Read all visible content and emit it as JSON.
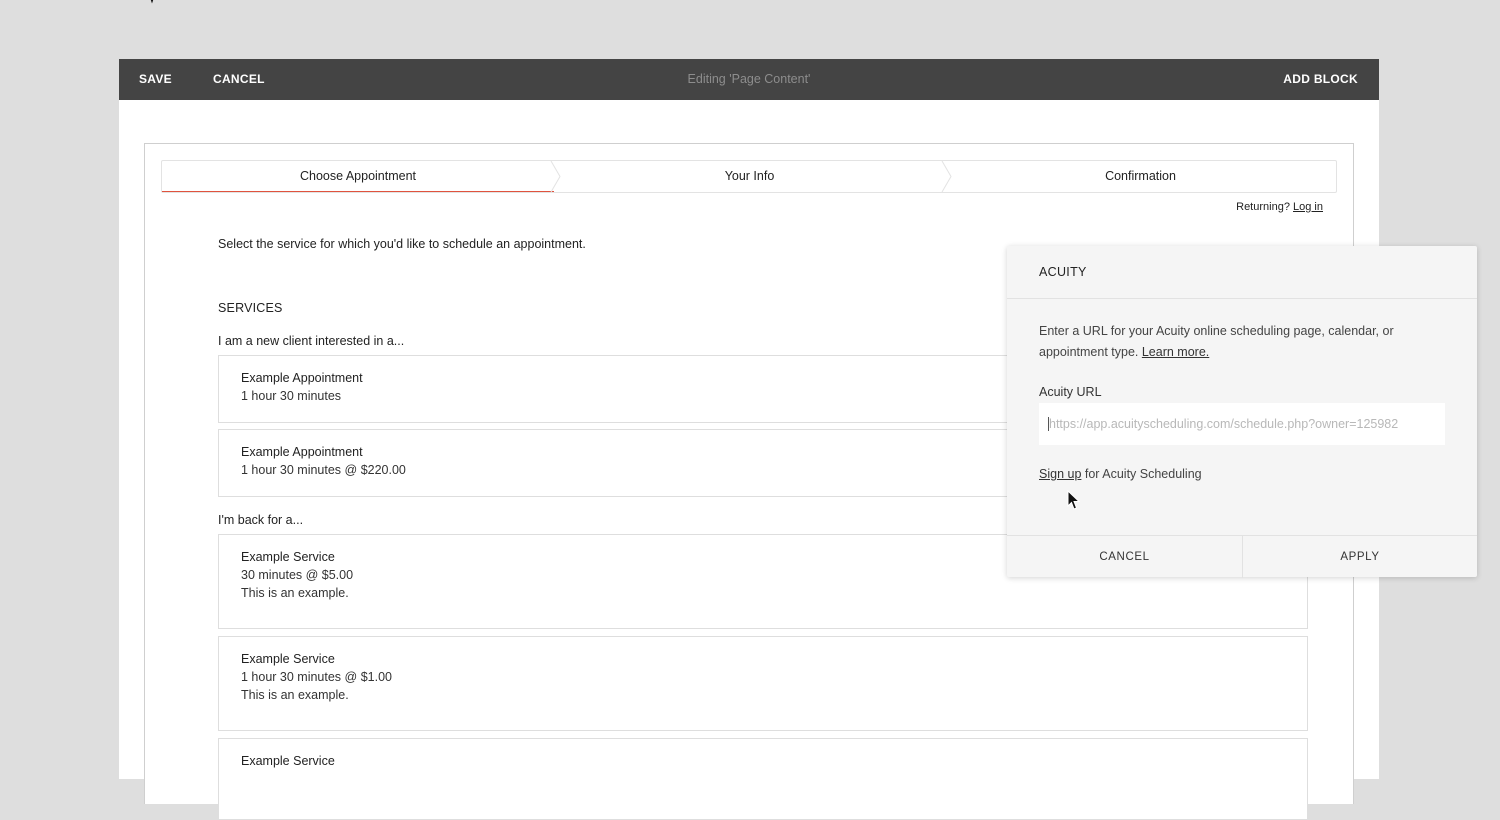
{
  "toolbar": {
    "save_label": "SAVE",
    "cancel_label": "CANCEL",
    "title": "Editing 'Page Content'",
    "add_block_label": "ADD BLOCK"
  },
  "steps": [
    {
      "label": "Choose Appointment",
      "active": true
    },
    {
      "label": "Your Info",
      "active": false
    },
    {
      "label": "Confirmation",
      "active": false
    }
  ],
  "returning": {
    "text": "Returning?",
    "link": "Log in"
  },
  "intro": "Select the service for which you'd like to schedule an appointment.",
  "services_heading": "SERVICES",
  "categories": [
    {
      "label": "I am a new client interested in a..."
    },
    {
      "label": "I'm back for a..."
    }
  ],
  "services": [
    {
      "name": "Example Appointment",
      "meta": "1 hour 30 minutes"
    },
    {
      "name": "Example Appointment",
      "meta": "1 hour 30 minutes @ $220.00"
    },
    {
      "name": "Example Service",
      "meta": "30 minutes @ $5.00",
      "desc": "This is an example."
    },
    {
      "name": "Example Service",
      "meta": "1 hour 30 minutes @ $1.00",
      "desc": "This is an example."
    },
    {
      "name": "Example Service"
    }
  ],
  "popover": {
    "title": "ACUITY",
    "description": "Enter a URL for your Acuity online scheduling page, calendar, or appointment type.",
    "learn_more": "Learn more.",
    "url_label": "Acuity URL",
    "url_value": "",
    "url_placeholder": "https://app.acuityscheduling.com/schedule.php?owner=125982",
    "signup_link": "Sign up",
    "signup_text": " for Acuity Scheduling",
    "cancel_label": "CANCEL",
    "apply_label": "APPLY"
  },
  "colors": {
    "toolbar_bg": "#444444",
    "active_step_underline": "#e0533e",
    "page_bg": "#dedede"
  },
  "icons": [
    "pointer-cursor-icon",
    "chevron-right-icon"
  ]
}
